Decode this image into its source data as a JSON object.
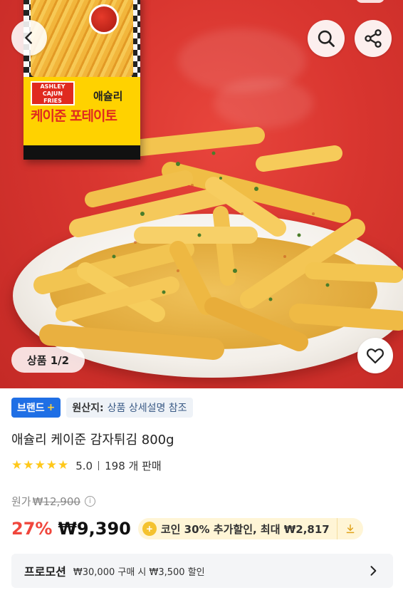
{
  "gallery": {
    "counter": "상품 1/2",
    "package_brand_line1": "ASHLEY",
    "package_brand_line2": "CAJUN",
    "package_brand_line3": "FRIES",
    "package_title_small": "애슐리",
    "package_title_large": "케이준 포테이토"
  },
  "toolbar": {
    "back_icon": "chevron-left-icon",
    "search_icon": "search-icon",
    "share_icon": "share-icon",
    "wishlist_icon": "heart-icon"
  },
  "badges": {
    "brand_label": "브랜드",
    "brand_plus": "+",
    "origin_key": "원산지:",
    "origin_value": "상품 상세설명 참조"
  },
  "product": {
    "title": "애슐리 케이준 감자튀김 800g",
    "rating": "5.0",
    "stars": 5,
    "sold": "198 개 판매"
  },
  "pricing": {
    "original_label": "원가",
    "original_price": "₩12,900",
    "discount_rate": "27%",
    "sale_price": "₩9,390",
    "coin_text": "코인 30% 추가할인, 최대 ₩2,817"
  },
  "promotion": {
    "label": "프로모션",
    "text": "₩30,000 구매 시 ₩3,500 할인"
  },
  "colors": {
    "hero_red": "#d8352f",
    "brand_blue": "#1f6fe5",
    "discount_red": "#f0463c",
    "star_yellow": "#ffc81a",
    "coin_bg": "#fff5d6"
  }
}
